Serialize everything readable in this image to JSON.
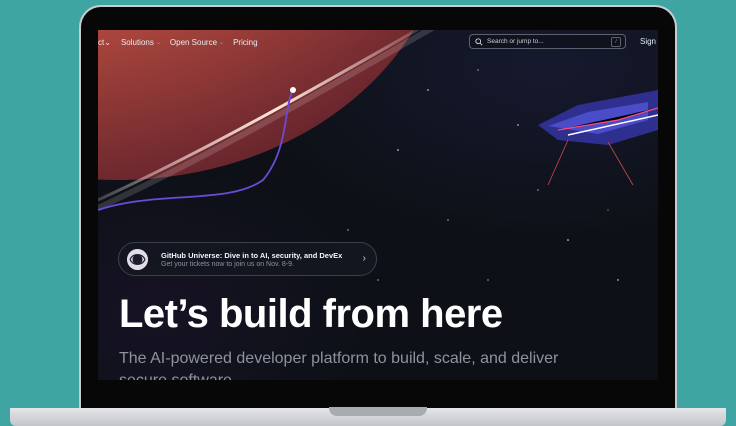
{
  "nav": {
    "first_item": "ct",
    "items": [
      {
        "label": "Solutions"
      },
      {
        "label": "Open Source"
      },
      {
        "label": "Pricing"
      }
    ],
    "search_placeholder": "Search or jump to...",
    "search_shortcut": "/",
    "signin_label": "Sign"
  },
  "banner": {
    "title": "GitHub Universe: Dive in to AI, security, and DevEx",
    "subtitle": "Get your tickets now to join us on Nov. 8-9."
  },
  "hero": {
    "title": "Let’s build from here",
    "subtitle": "The AI-powered developer platform to build, scale, and deliver secure software"
  },
  "colors": {
    "background": "#3ea5a3",
    "screen": "#0d1117",
    "planet": "#c75a48",
    "orbit_line": "#6a4bd8"
  },
  "icons": [
    "chevron-down-icon",
    "search-icon",
    "chevron-right-icon",
    "universe-logo-icon"
  ]
}
